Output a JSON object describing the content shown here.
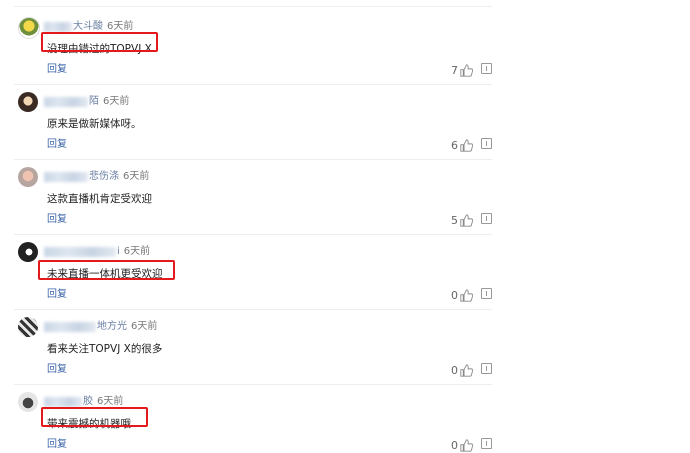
{
  "comments": [
    {
      "name": "大斗酸",
      "time": "6天前",
      "text": "没理由错过的TOPVJ X",
      "reply": "回复",
      "likes": "7"
    },
    {
      "name": "陌",
      "time": "6天前",
      "text": "原来是做新媒体呀。",
      "reply": "回复",
      "likes": "6"
    },
    {
      "name": "悲伤涤",
      "time": "6天前",
      "text": "这款直播机肯定受欢迎",
      "reply": "回复",
      "likes": "5"
    },
    {
      "name": "i",
      "time": "6天前",
      "text": "未来直播一体机更受欢迎",
      "reply": "回复",
      "likes": "0"
    },
    {
      "name": "地方光",
      "time": "6天前",
      "text": "看来关注TOPVJ X的很多",
      "reply": "回复",
      "likes": "0"
    },
    {
      "name": "胶",
      "time": "6天前",
      "text": "带来震撼的机器哦",
      "reply": "回复",
      "likes": "0"
    }
  ],
  "colors": {
    "highlight_border": "#e3191c",
    "username": "#6a7fa3",
    "reply_link": "#3b65a8"
  },
  "icons": [
    "thumbs-up-icon",
    "report-icon"
  ]
}
